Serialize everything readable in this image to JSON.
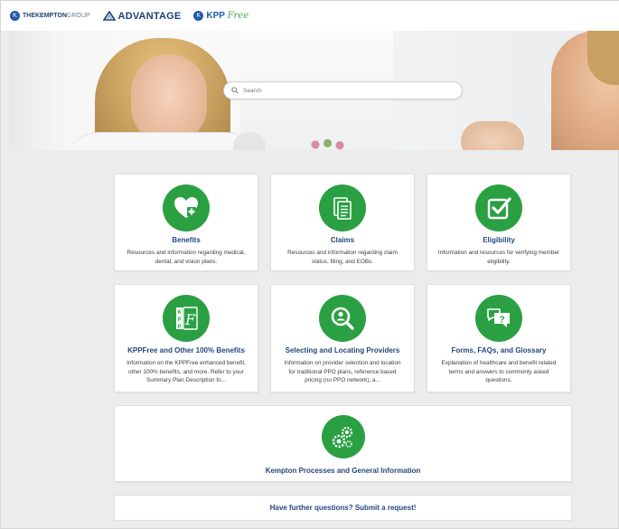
{
  "header": {
    "logo_kempton_main": "THEKEMPTON",
    "logo_kempton_sub": "GROUP",
    "logo_advantage": "ADVANTAGE",
    "logo_kpp": "KPP",
    "logo_kpp_script": "Free"
  },
  "search": {
    "placeholder": "Search"
  },
  "cards": [
    {
      "title": "Benefits",
      "desc": "Resources and information regarding medical, dental, and vision plans.",
      "icon": "heart-plus-icon"
    },
    {
      "title": "Claims",
      "desc": "Resources and information regarding claim status, filing, and EOBs.",
      "icon": "documents-icon"
    },
    {
      "title": "Eligibility",
      "desc": "Information and resources for verifying member eligibility.",
      "icon": "checkbox-icon"
    },
    {
      "title": "KPPFree and Other 100% Benefits",
      "desc": "Information on the KPPFree enhanced benefit, other 100% benefits, and more. Refer to your Summary Plan Description fo...",
      "icon": "kpp-free-icon"
    },
    {
      "title": "Selecting and Locating Providers",
      "desc": "Information on provider selection and location for traditional PPO plans, reference based pricing (no PPO network), a...",
      "icon": "magnifier-person-icon"
    },
    {
      "title": "Forms, FAQs, and Glossary",
      "desc": "Explanation of healthcare and benefit related terms and answers to commonly asked questions.",
      "icon": "chat-question-icon"
    },
    {
      "title": "Kempton Processes and General Information",
      "desc": "",
      "icon": "gears-icon"
    }
  ],
  "cta": {
    "label": "Have further questions? Submit a request!"
  },
  "colors": {
    "green": "#2aa043",
    "navy": "#25477d"
  }
}
